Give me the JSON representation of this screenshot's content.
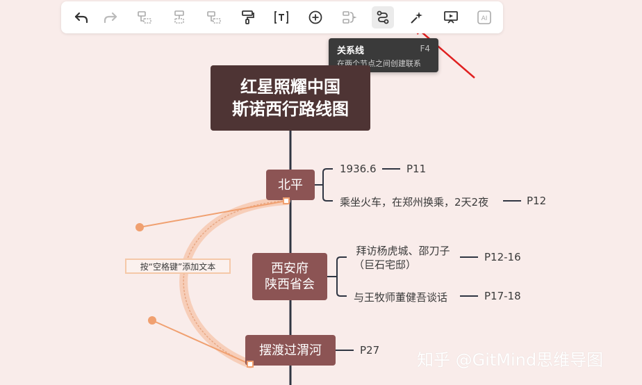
{
  "toolbar": {
    "tools": [
      {
        "name": "undo-icon"
      },
      {
        "name": "redo-icon"
      },
      {
        "name": "insert-child-icon"
      },
      {
        "name": "insert-sibling-icon"
      },
      {
        "name": "insert-parent-icon"
      },
      {
        "name": "format-painter-icon"
      },
      {
        "name": "text-icon"
      },
      {
        "name": "add-icon"
      },
      {
        "name": "summary-icon"
      },
      {
        "name": "relationship-line-icon"
      },
      {
        "name": "theme-magic-icon"
      },
      {
        "name": "presentation-icon"
      },
      {
        "name": "ai-icon"
      }
    ],
    "active": "relationship-line-icon",
    "ai_label": "AI"
  },
  "tooltip": {
    "title": "关系线",
    "shortcut": "F4",
    "description": "在两个节点之间创建联系"
  },
  "mindmap": {
    "root": {
      "line1": "红星照耀中国",
      "line2": "斯诺西行路线图"
    },
    "topics": {
      "beiping": {
        "label": "北平",
        "subs": [
          {
            "text": "1936.6",
            "page": "P11"
          },
          {
            "text": "乘坐火车，在郑州换乘，2天2夜",
            "page": "P12"
          }
        ]
      },
      "xian": {
        "line1": "西安府",
        "line2": "陕西省会",
        "subs": [
          {
            "line1": "拜访杨虎城、邵刀子",
            "line2": "（巨石宅邸）",
            "page": "P12-16"
          },
          {
            "text": "与王牧师董健吾谈话",
            "page": "P17-18"
          }
        ]
      },
      "duhe": {
        "label": "摆渡过渭河",
        "subs": [
          {
            "page": "P27"
          }
        ]
      }
    },
    "relation_label": "按“空格键”添加文本"
  },
  "watermark": "知乎 @GitMind思维导图",
  "colors": {
    "root": "#4e3434",
    "topic": "#8c5454",
    "relation": "#f0a070",
    "arrow": "#e02020"
  }
}
